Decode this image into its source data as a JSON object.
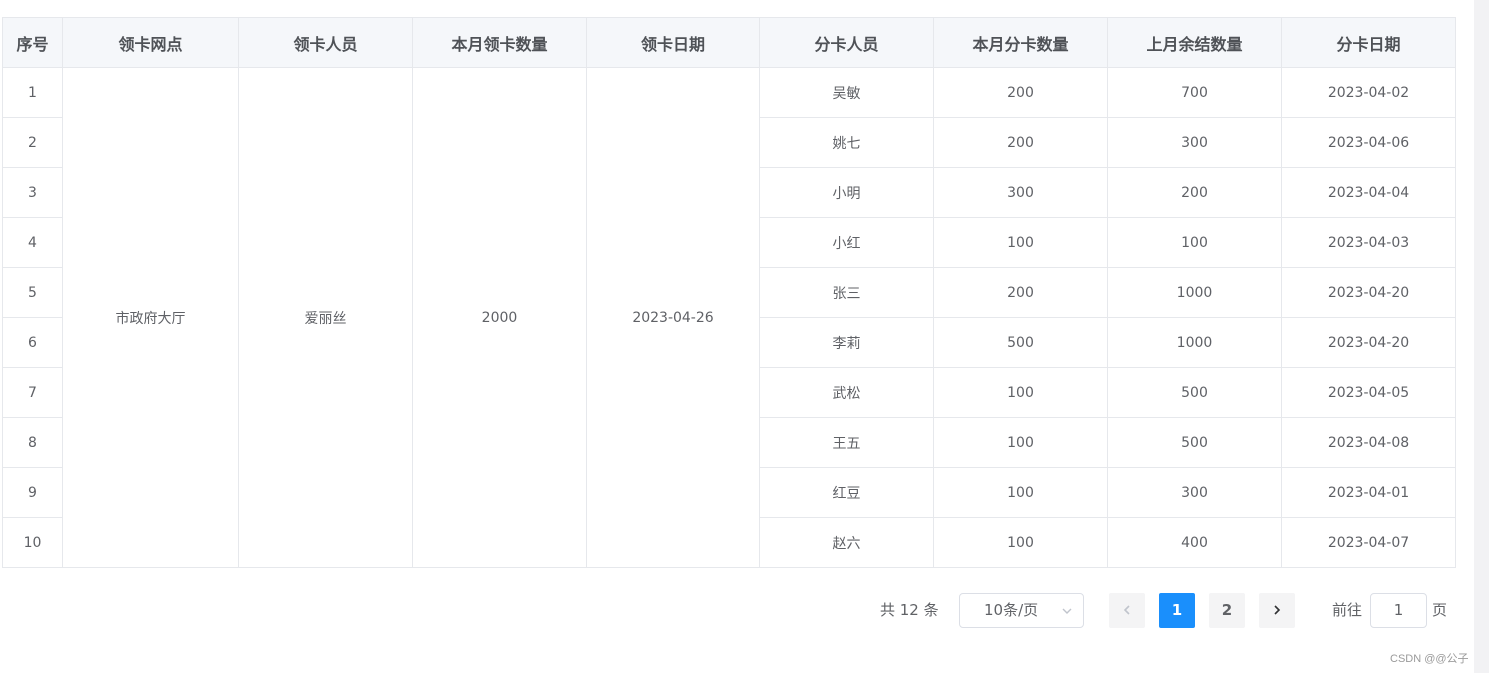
{
  "table": {
    "headers": [
      "序号",
      "领卡网点",
      "领卡人员",
      "本月领卡数量",
      "领卡日期",
      "分卡人员",
      "本月分卡数量",
      "上月余结数量",
      "分卡日期"
    ],
    "merged": {
      "outlet": "市政府大厅",
      "receiver": "爱丽丝",
      "monthly_received": "2000",
      "receive_date": "2023-04-26"
    },
    "rows": [
      {
        "no": "1",
        "distributor": "吴敏",
        "monthly_distributed": "200",
        "last_month_balance": "700",
        "distribute_date": "2023-04-02"
      },
      {
        "no": "2",
        "distributor": "姚七",
        "monthly_distributed": "200",
        "last_month_balance": "300",
        "distribute_date": "2023-04-06"
      },
      {
        "no": "3",
        "distributor": "小明",
        "monthly_distributed": "300",
        "last_month_balance": "200",
        "distribute_date": "2023-04-04"
      },
      {
        "no": "4",
        "distributor": "小红",
        "monthly_distributed": "100",
        "last_month_balance": "100",
        "distribute_date": "2023-04-03"
      },
      {
        "no": "5",
        "distributor": "张三",
        "monthly_distributed": "200",
        "last_month_balance": "1000",
        "distribute_date": "2023-04-20"
      },
      {
        "no": "6",
        "distributor": "李莉",
        "monthly_distributed": "500",
        "last_month_balance": "1000",
        "distribute_date": "2023-04-20"
      },
      {
        "no": "7",
        "distributor": "武松",
        "monthly_distributed": "100",
        "last_month_balance": "500",
        "distribute_date": "2023-04-05"
      },
      {
        "no": "8",
        "distributor": "王五",
        "monthly_distributed": "100",
        "last_month_balance": "500",
        "distribute_date": "2023-04-08"
      },
      {
        "no": "9",
        "distributor": "红豆",
        "monthly_distributed": "100",
        "last_month_balance": "300",
        "distribute_date": "2023-04-01"
      },
      {
        "no": "10",
        "distributor": "赵六",
        "monthly_distributed": "100",
        "last_month_balance": "400",
        "distribute_date": "2023-04-07"
      }
    ]
  },
  "pagination": {
    "total_text": "共 12 条",
    "page_size_label": "10条/页",
    "pages": [
      "1",
      "2"
    ],
    "current_page": 1,
    "goto_prefix": "前往",
    "goto_value": "1",
    "goto_suffix": "页",
    "prev_icon": "chevron-left-icon",
    "next_icon": "chevron-right-icon",
    "select_icon": "chevron-down-icon"
  },
  "watermark": "CSDN @@公子"
}
